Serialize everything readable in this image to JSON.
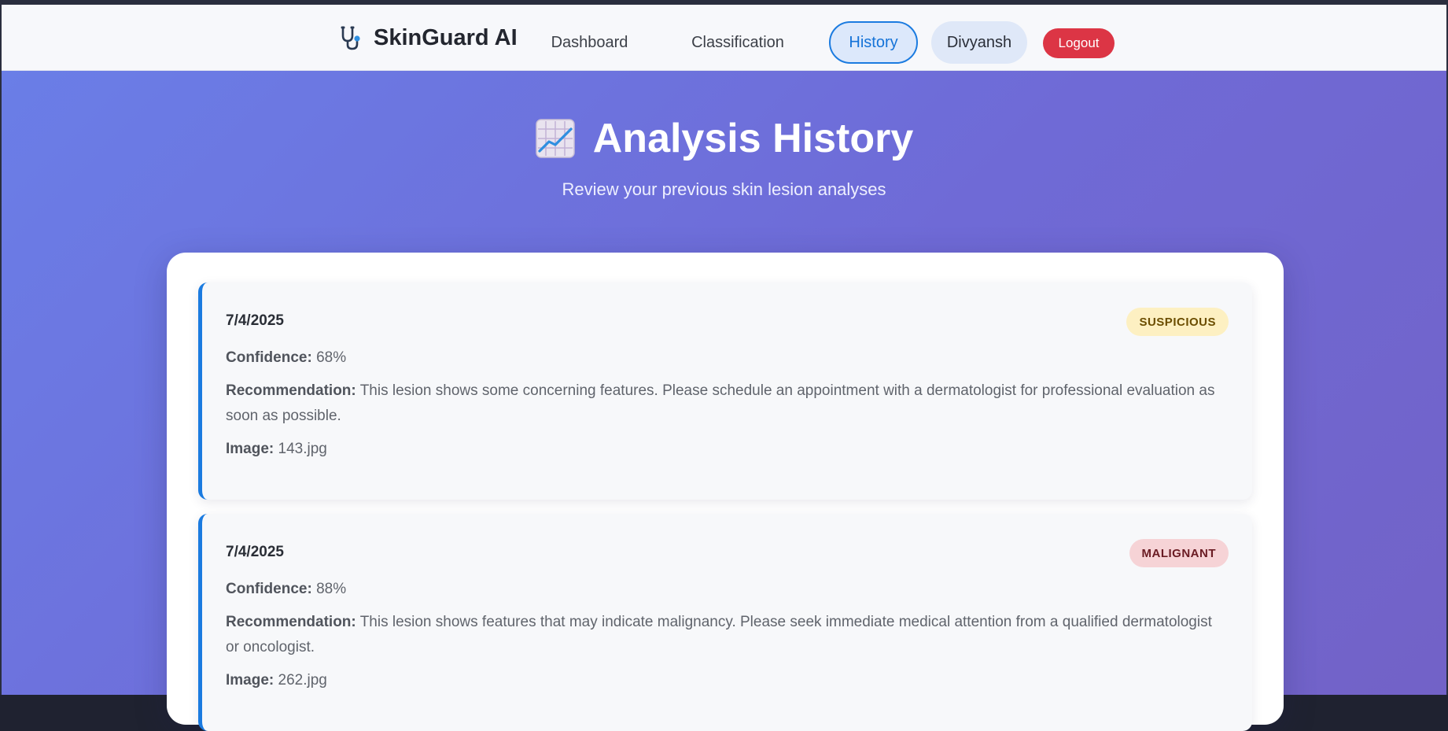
{
  "navbar": {
    "brand": "SkinGuard AI",
    "brand_icon": "stethoscope-icon",
    "links": [
      "Dashboard",
      "Classification",
      "History"
    ],
    "active": "History",
    "user": "Divyansh",
    "logout": "Logout",
    "logout_color": "#dc3545"
  },
  "header": {
    "icon": "chart-increasing-icon",
    "title": "Analysis History",
    "subtitle": "Review your previous skin lesion analyses"
  },
  "labels": {
    "confidence": "Confidence:",
    "recommendation": "Recommendation:",
    "image": "Image:"
  },
  "history": [
    {
      "date": "7/4/2025",
      "status": "SUSPICIOUS",
      "status_color": "#fdf0c2",
      "confidence": "68%",
      "recommendation": "This lesion shows some concerning features. Please schedule an appointment with a dermatologist for professional evaluation as soon as possible.",
      "image": "143.jpg"
    },
    {
      "date": "7/4/2025",
      "status": "MALIGNANT",
      "status_color": "#f6d3d6",
      "confidence": "88%",
      "recommendation": "This lesion shows features that may indicate malignancy. Please seek immediate medical attention from a qualified dermatologist or oncologist.",
      "image": "262.jpg"
    }
  ],
  "colors": {
    "accent": "#1b7be0",
    "background_gradient_start": "#6a7fe8",
    "background_gradient_end": "#7262c7"
  }
}
